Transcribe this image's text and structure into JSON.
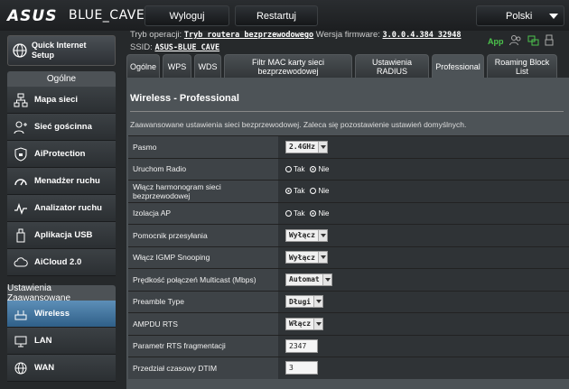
{
  "header": {
    "brand": "ASUS",
    "model": "BLUE_CAVE",
    "logout": "Wyloguj",
    "restart": "Restartuj",
    "language": "Polski"
  },
  "sidebar": {
    "qis": "Quick Internet Setup",
    "general_title": "Ogólne",
    "general_items": [
      {
        "label": "Mapa sieci",
        "icon": "network-map-icon"
      },
      {
        "label": "Sieć gościnna",
        "icon": "guest-network-icon"
      },
      {
        "label": "AiProtection",
        "icon": "aiprotection-icon"
      },
      {
        "label": "Menadżer ruchu",
        "icon": "traffic-manager-icon"
      },
      {
        "label": "Analizator ruchu",
        "icon": "traffic-analyzer-icon"
      },
      {
        "label": "Aplikacja USB",
        "icon": "usb-icon"
      },
      {
        "label": "AiCloud 2.0",
        "icon": "cloud-icon"
      }
    ],
    "advanced_title": "Ustawienia Zaawansowane",
    "advanced_items": [
      {
        "label": "Wireless",
        "icon": "wireless-icon"
      },
      {
        "label": "LAN",
        "icon": "lan-icon"
      },
      {
        "label": "WAN",
        "icon": "wan-icon"
      }
    ]
  },
  "status": {
    "mode_label": "Tryb operacji:",
    "mode_value": "Tryb routera bezprzewodowego",
    "fw_label": "Wersja firmware:",
    "fw_value": "3.0.0.4.384_32948",
    "ssid_label": "SSID:",
    "ssid_value": "ASUS-BLUE_CAVE",
    "app": "App"
  },
  "tabs": [
    {
      "label": "Ogólne",
      "w": 37
    },
    {
      "label": "WPS",
      "w": 32
    },
    {
      "label": "WDS",
      "w": 30
    },
    {
      "label": "Filtr MAC karty sieci bezprzewodowej",
      "w": 142
    },
    {
      "label": "Ustawienia RADIUS",
      "w": 82
    },
    {
      "label": "Professional",
      "w": 58
    },
    {
      "label": "Roaming Block List",
      "w": 78
    }
  ],
  "panel": {
    "title": "Wireless - Professional",
    "description": "Zaawansowane ustawienia sieci bezprzewodowej. Zaleca się pozostawienie ustawień domyślnych."
  },
  "settings": [
    {
      "label": "Pasmo",
      "type": "select",
      "value": "2.4GHz"
    },
    {
      "label": "Uruchom Radio",
      "type": "radio",
      "options": [
        "Tak",
        "Nie"
      ],
      "selected": 1
    },
    {
      "label": "Włącz harmonogram sieci bezprzewodowej",
      "type": "radio",
      "options": [
        "Tak",
        "Nie"
      ],
      "selected": 0
    },
    {
      "label": "Izolacja AP",
      "type": "radio",
      "options": [
        "Tak",
        "Nie"
      ],
      "selected": 1
    },
    {
      "label": "Pomocnik przesyłania",
      "type": "select",
      "value": "Wyłącz"
    },
    {
      "label": "Włącz IGMP Snooping",
      "type": "select",
      "value": "Wyłącz"
    },
    {
      "label": "Prędkość połączeń Multicast (Mbps)",
      "type": "select",
      "value": "Automat"
    },
    {
      "label": "Preamble Type",
      "type": "select",
      "value": "Długi"
    },
    {
      "label": "AMPDU RTS",
      "type": "select",
      "value": "Włącz"
    },
    {
      "label": "Parametr RTS fragmentacji",
      "type": "text",
      "value": "2347"
    },
    {
      "label": "Przedział czasowy DTIM",
      "type": "text",
      "value": "3"
    }
  ],
  "colors": {
    "accent": "#3b6e99",
    "background": "#26292b",
    "panel": "#4d5357"
  }
}
